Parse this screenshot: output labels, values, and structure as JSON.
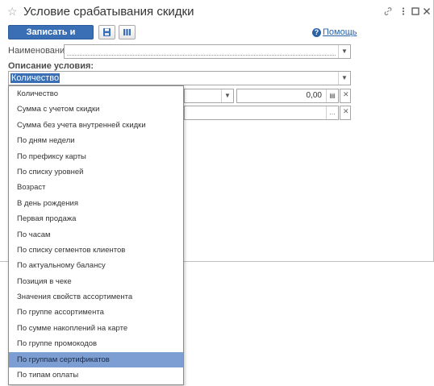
{
  "window": {
    "title": "Условие срабатывания скидки"
  },
  "toolbar": {
    "save_close_label": "Записать и закрыть",
    "help_label": "Помощь"
  },
  "form": {
    "name_label": "Наименование:",
    "name_value": "",
    "condition_label": "Описание условия:",
    "condition_value": "Количество",
    "amount_value": "0,00"
  },
  "dropdown": {
    "items": [
      "Количество",
      "Сумма с учетом скидки",
      "Сумма без учета внутренней скидки",
      "По дням недели",
      "По префиксу карты",
      "По списку уровней",
      "Возраст",
      "В день рождения",
      "Первая продажа",
      "По часам",
      "По списку сегментов клиентов",
      "По актуальному балансу",
      "Позиция в чеке",
      "Значения свойств ассортимента",
      "По группе ассортимента",
      "По сумме накоплений на карте",
      "По группе промокодов",
      "По группам сертификатов",
      "По типам оплаты"
    ],
    "active_index": 17
  },
  "colors": {
    "primary_button": "#3a6fb5",
    "selection": "#3a6fb5",
    "highlight_row": "#7c9ed2",
    "link": "#2a62a8"
  }
}
